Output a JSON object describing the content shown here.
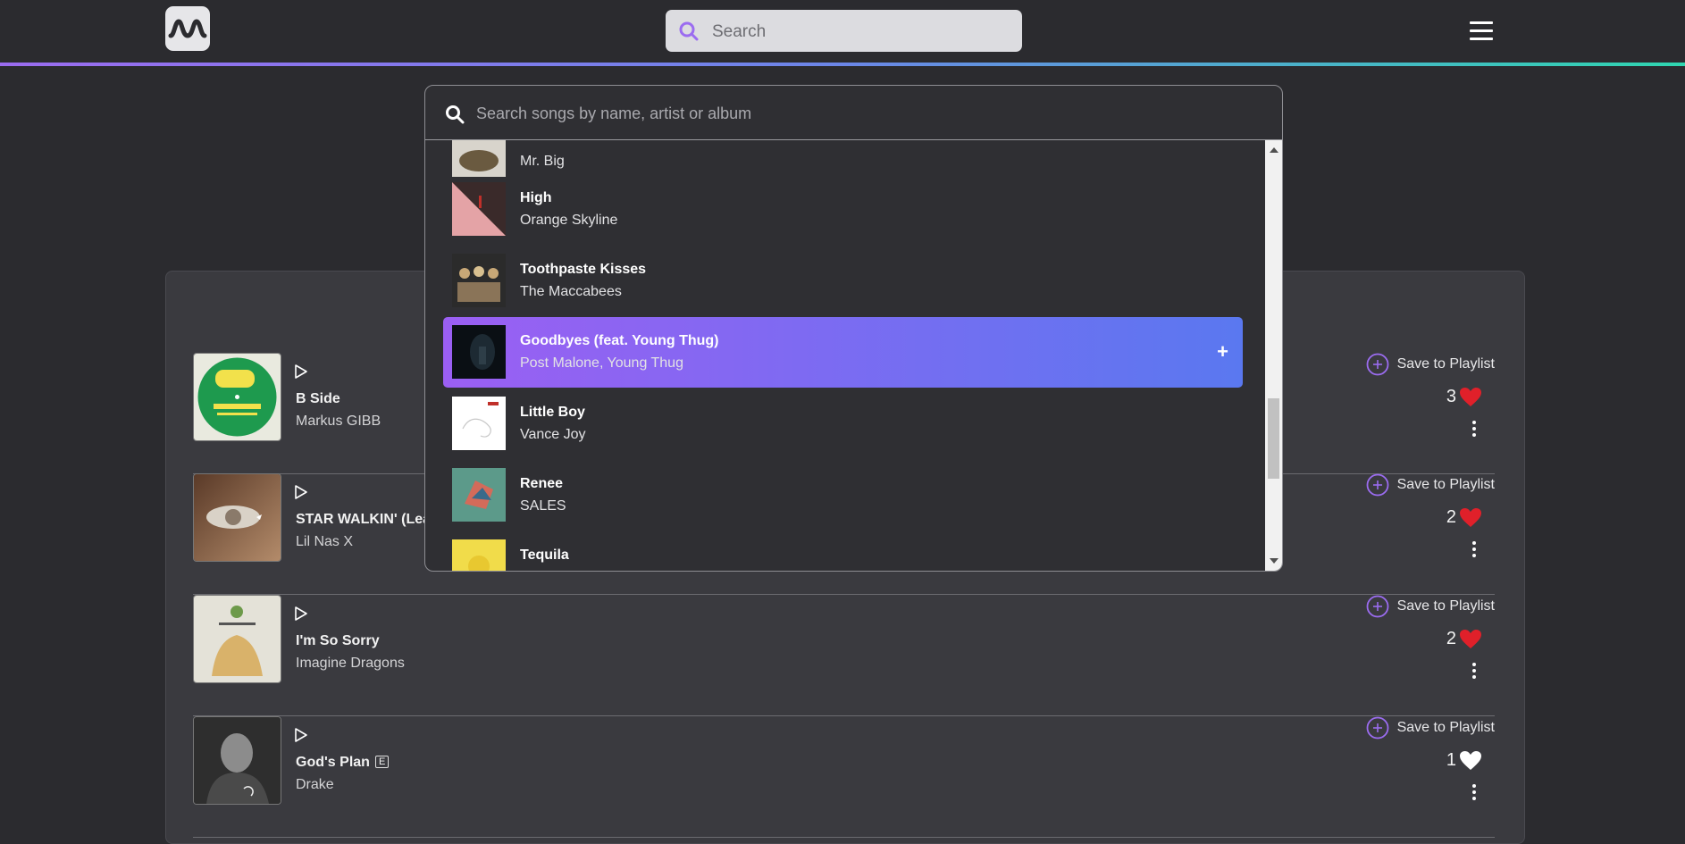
{
  "header": {
    "logo_icon": "wave-logo-icon",
    "search_placeholder": "Search",
    "menu_icon": "hamburger-icon"
  },
  "song_search": {
    "placeholder": "Search songs by name, artist or album",
    "results": [
      {
        "title": "",
        "artist": "Mr. Big",
        "art_colors": [
          "#d8d4cc",
          "#6a5a40"
        ]
      },
      {
        "title": "High",
        "artist": "Orange Skyline",
        "art_colors": [
          "#e4a3a6",
          "#3a2a2a"
        ]
      },
      {
        "title": "Toothpaste Kisses",
        "artist": "The Maccabees",
        "art_colors": [
          "#c8a877",
          "#2b2b2b"
        ]
      },
      {
        "title": "Goodbyes (feat. Young Thug)",
        "artist": "Post Malone, Young Thug",
        "art_colors": [
          "#1d2a33",
          "#0a0f14"
        ],
        "highlighted": true,
        "action": "+"
      },
      {
        "title": "Little Boy",
        "artist": "Vance Joy",
        "art_colors": [
          "#ffffff",
          "#c8c8c8"
        ]
      },
      {
        "title": "Renee",
        "artist": "SALES",
        "art_colors": [
          "#5c9a8a",
          "#d36b5a"
        ]
      },
      {
        "title": "Tequila",
        "artist": "",
        "art_colors": [
          "#f1dc4a",
          "#e8c830"
        ]
      }
    ]
  },
  "playlist": {
    "save_label": "Save to Playlist",
    "songs": [
      {
        "title": "B Side",
        "artist": "Markus GIBB",
        "likes": "3",
        "liked": true,
        "explicit": false
      },
      {
        "title": "STAR WALKIN' (Leag",
        "artist": "Lil Nas X",
        "likes": "2",
        "liked": true,
        "explicit": false
      },
      {
        "title": "I'm So Sorry",
        "artist": "Imagine Dragons",
        "likes": "2",
        "liked": true,
        "explicit": false
      },
      {
        "title": "God's Plan",
        "artist": "Drake",
        "likes": "1",
        "liked": false,
        "explicit": true,
        "explicit_label": "E"
      }
    ]
  },
  "colors": {
    "accent_purple": "#9b5ff3",
    "accent_blue": "#5a78f0",
    "like_red": "#e0202a",
    "background": "#2b2b2f"
  }
}
